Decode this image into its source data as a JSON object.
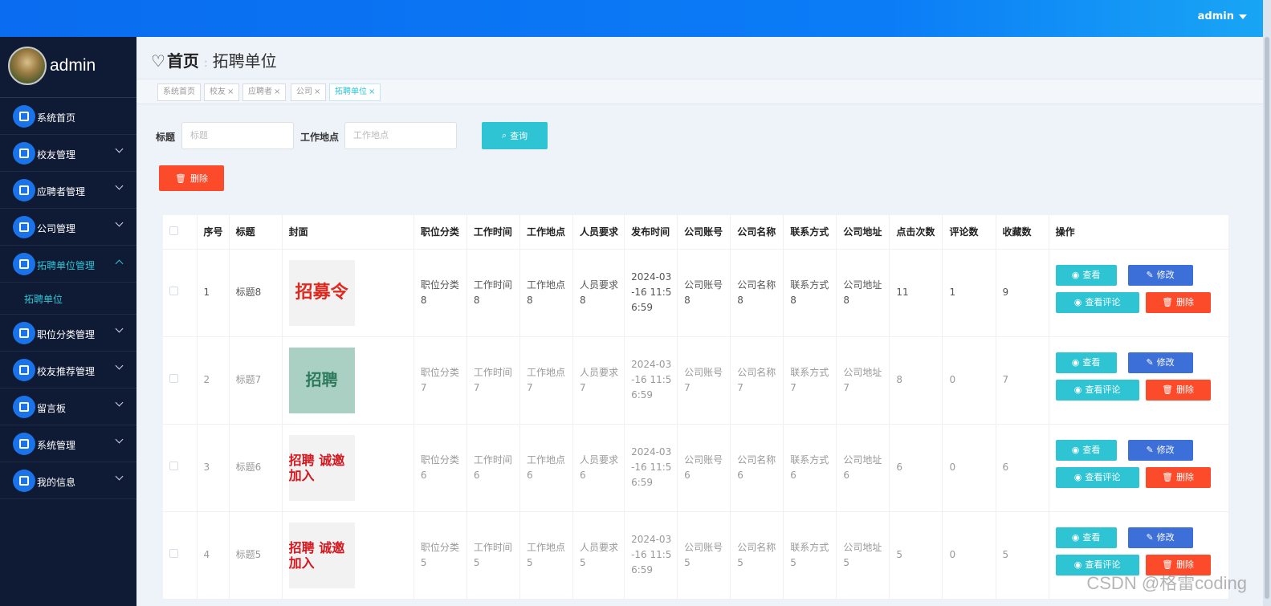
{
  "topbar": {
    "user": "admin"
  },
  "sidebar": {
    "username": "admin",
    "items": [
      {
        "label": "系统首页",
        "icon": "home-icon",
        "has_children": false
      },
      {
        "label": "校友管理",
        "icon": "user-icon",
        "has_children": true
      },
      {
        "label": "应聘者管理",
        "icon": "briefcase-icon",
        "has_children": true
      },
      {
        "label": "公司管理",
        "icon": "grid-icon",
        "has_children": true
      },
      {
        "label": "拓聘单位管理",
        "icon": "list-icon",
        "has_children": true,
        "expanded": true,
        "children": [
          {
            "label": "拓聘单位"
          }
        ]
      },
      {
        "label": "职位分类管理",
        "icon": "ticket-icon",
        "has_children": true
      },
      {
        "label": "校友推荐管理",
        "icon": "grid-icon",
        "has_children": true
      },
      {
        "label": "留言板",
        "icon": "grid-icon",
        "has_children": true
      },
      {
        "label": "系统管理",
        "icon": "clipboard-icon",
        "has_children": true
      },
      {
        "label": "我的信息",
        "icon": "card-icon",
        "has_children": true
      }
    ]
  },
  "breadcrumb": {
    "home": "首页",
    "current": "拓聘单位"
  },
  "tags": [
    {
      "label": "系统首页",
      "closable": false
    },
    {
      "label": "校友",
      "closable": true
    },
    {
      "label": "应聘者",
      "closable": true
    },
    {
      "label": "公司",
      "closable": true
    },
    {
      "label": "拓聘单位",
      "closable": true,
      "active": true
    }
  ],
  "search": {
    "title_label": "标题",
    "title_placeholder": "标题",
    "location_label": "工作地点",
    "location_placeholder": "工作地点",
    "button": "查询"
  },
  "batch_delete": "删除",
  "table": {
    "columns": [
      "序号",
      "标题",
      "封面",
      "职位分类",
      "工作时间",
      "工作地点",
      "人员要求",
      "发布时间",
      "公司账号",
      "公司名称",
      "联系方式",
      "公司地址",
      "点击次数",
      "评论数",
      "收藏数",
      "操作"
    ],
    "rows": [
      {
        "no": "1",
        "title": "标题8",
        "cover": "招募令",
        "category": "职位分类8",
        "time": "工作时间8",
        "place": "工作地点8",
        "req": "人员要求8",
        "published": "2024-03-16 11:56:59",
        "account": "公司账号8",
        "company": "公司名称8",
        "contact": "联系方式8",
        "address": "公司地址8",
        "clicks": "11",
        "comments": "1",
        "favorites": "9"
      },
      {
        "no": "2",
        "title": "标题7",
        "cover": "招聘",
        "category": "职位分类7",
        "time": "工作时间7",
        "place": "工作地点7",
        "req": "人员要求7",
        "published": "2024-03-16 11:56:59",
        "account": "公司账号7",
        "company": "公司名称7",
        "contact": "联系方式7",
        "address": "公司地址7",
        "clicks": "8",
        "comments": "0",
        "favorites": "7"
      },
      {
        "no": "3",
        "title": "标题6",
        "cover": "招聘 诚邀加入",
        "category": "职位分类6",
        "time": "工作时间6",
        "place": "工作地点6",
        "req": "人员要求6",
        "published": "2024-03-16 11:56:59",
        "account": "公司账号6",
        "company": "公司名称6",
        "contact": "联系方式6",
        "address": "公司地址6",
        "clicks": "6",
        "comments": "0",
        "favorites": "6"
      },
      {
        "no": "4",
        "title": "标题5",
        "cover": "招聘 诚邀加入",
        "category": "职位分类5",
        "time": "工作时间5",
        "place": "工作地点5",
        "req": "人员要求5",
        "published": "2024-03-16 11:56:59",
        "account": "公司账号5",
        "company": "公司名称5",
        "contact": "联系方式5",
        "address": "公司地址5",
        "clicks": "5",
        "comments": "0",
        "favorites": "5"
      }
    ],
    "actions": {
      "view": "查看",
      "edit": "修改",
      "comments": "查看评论",
      "delete": "删除"
    }
  },
  "watermark": "CSDN @格雷coding",
  "colors": {
    "topbar": "#0a6cf0",
    "sidebar": "#0f1a35",
    "accent": "#2ec4d4",
    "danger": "#fc4b2a",
    "primary": "#3d6fd8"
  }
}
